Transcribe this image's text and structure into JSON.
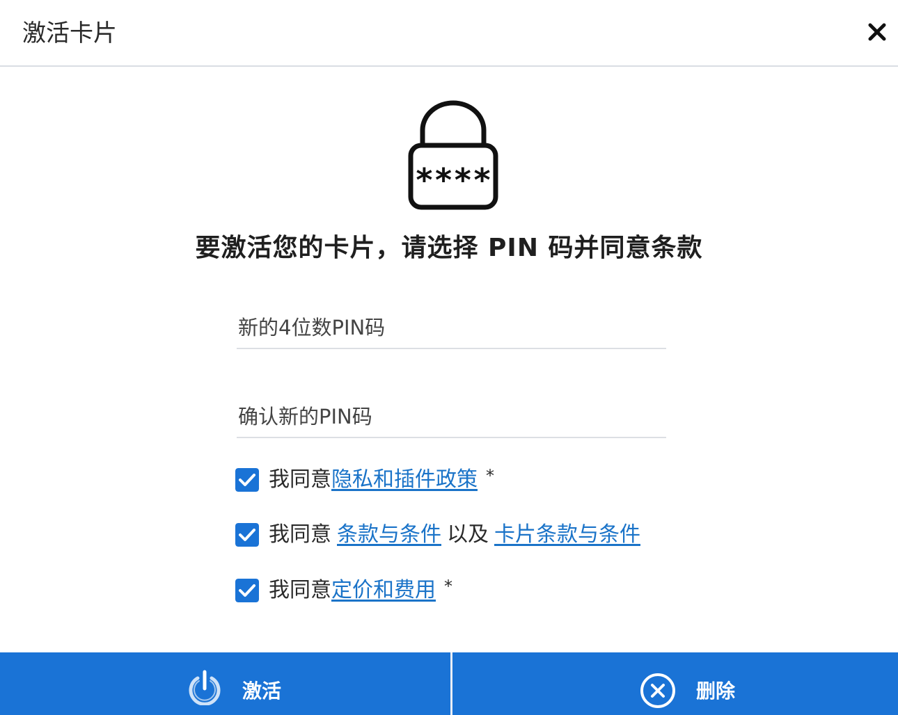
{
  "header": {
    "title": "激活卡片",
    "close_icon": "close-icon"
  },
  "lock": {
    "icon": "lock-icon",
    "mask": "****"
  },
  "heading": "要激活您的卡片，请选择 PIN 码并同意条款",
  "form": {
    "pin_placeholder": "新的4位数PIN码",
    "confirm_placeholder": "确认新的PIN码"
  },
  "agreements": [
    {
      "checked": true,
      "prefix": "我同意",
      "link1": "隐私和插件政策",
      "suffix": "*"
    },
    {
      "checked": true,
      "prefix": "我同意",
      "link1": "条款与条件",
      "middle": "以及",
      "link2": "卡片条款与条件"
    },
    {
      "checked": true,
      "prefix": "我同意",
      "link1": "定价和费用",
      "suffix": "*"
    }
  ],
  "footer": {
    "activate_label": "激活",
    "activate_icon": "power-icon",
    "delete_label": "删除",
    "delete_icon": "circle-x-icon"
  },
  "colors": {
    "accent": "#1a73d6",
    "link": "#1a73c8",
    "checkbox": "#1a73d6"
  }
}
